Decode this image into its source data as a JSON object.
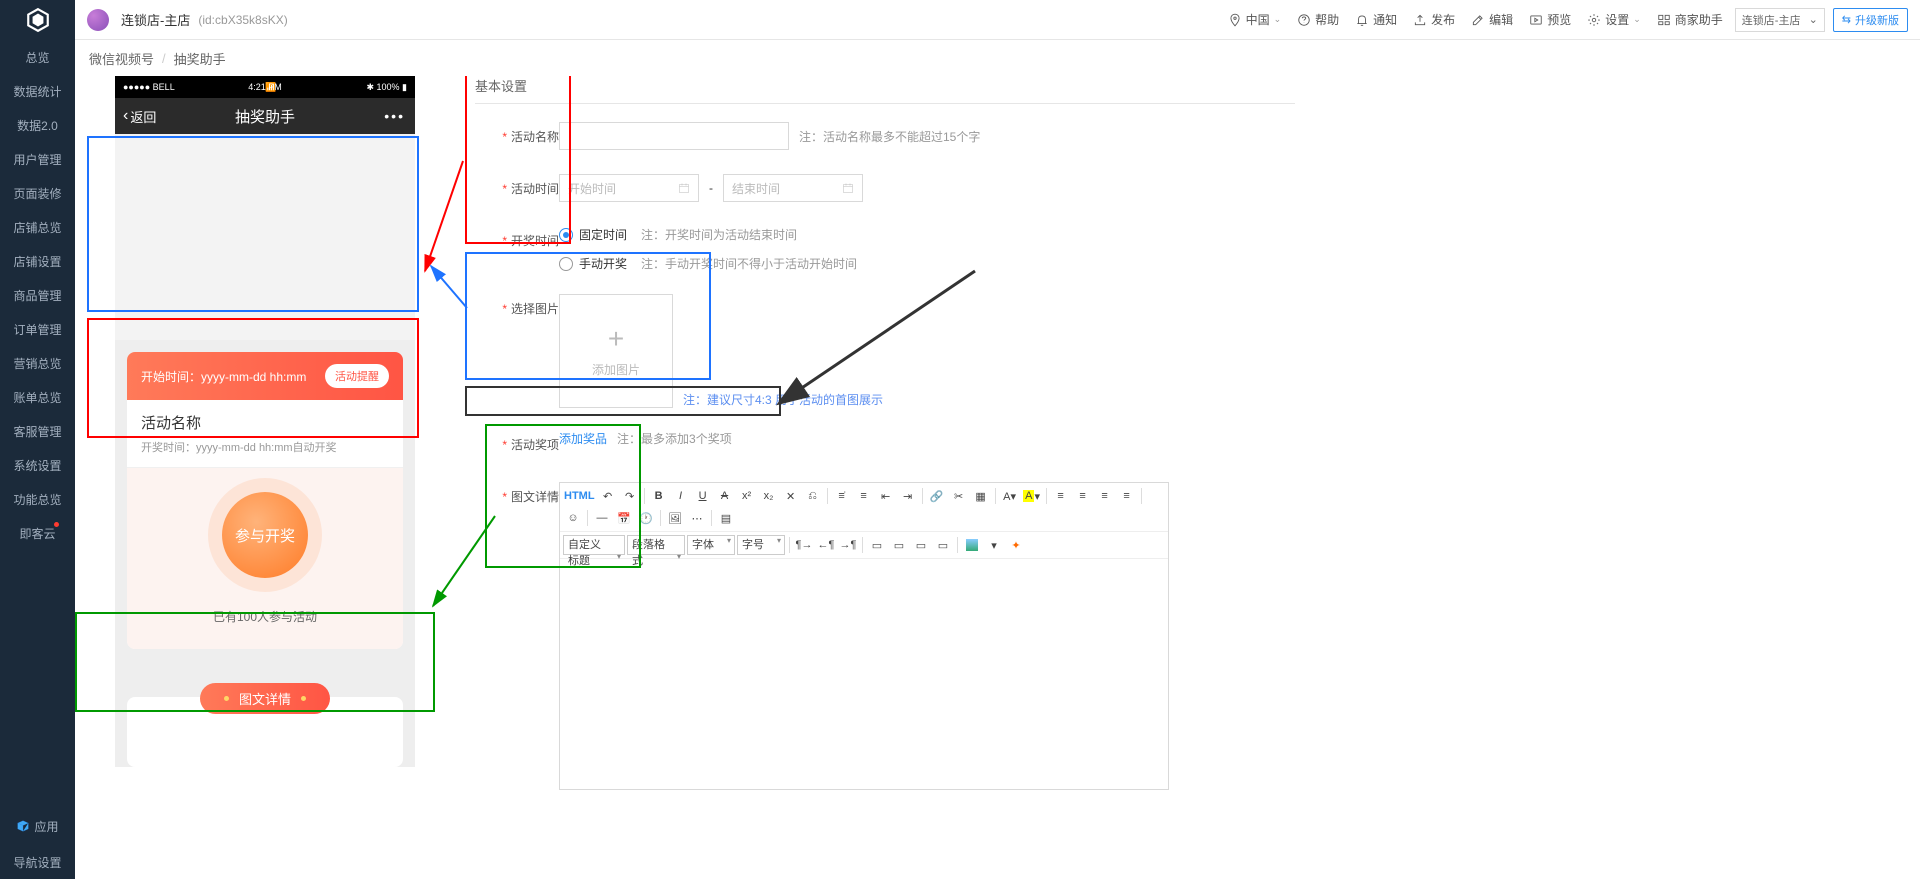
{
  "sidebar": {
    "items": [
      "总览",
      "数据统计",
      "数据2.0",
      "用户管理",
      "页面装修",
      "店铺总览",
      "店铺设置",
      "商品管理",
      "订单管理",
      "营销总览",
      "账单总览",
      "客服管理",
      "系统设置",
      "功能总览",
      "即客云"
    ],
    "app": "应用",
    "nav_settings": "导航设置"
  },
  "header": {
    "shop_name": "连锁店-主店",
    "shop_id": "(id:cbX35k8sKX)",
    "region": "中国",
    "help": "帮助",
    "notify": "通知",
    "publish": "发布",
    "edit": "编辑",
    "preview": "预览",
    "settings": "设置",
    "assistant": "商家助手",
    "shop_select": "连锁店-主店",
    "upgrade": "升级新版"
  },
  "breadcrumb": {
    "a": "微信视频号",
    "b": "抽奖助手"
  },
  "phone": {
    "carrier": "●●●●● BELL",
    "time": "4:21 PM",
    "battery": "100%",
    "back": "返回",
    "title": "抽奖助手",
    "start_label": "开始时间：",
    "start_val": "yyyy-mm-dd hh:mm",
    "remind": "活动提醒",
    "act_name": "活动名称",
    "open_label": "开奖时间：yyyy-mm-dd hh:mm自动开奖",
    "join": "参与开奖",
    "count": "已有100人参与活动",
    "detail": "图文详情"
  },
  "form": {
    "section": "基本设置",
    "name_lbl": "活动名称",
    "name_note": "注：活动名称最多不能超过15个字",
    "time_lbl": "活动时间",
    "start_ph": "开始时间",
    "end_ph": "结束时间",
    "open_lbl": "开奖时间",
    "open_fixed": "固定时间",
    "open_fixed_note": "注：开奖时间为活动结束时间",
    "open_manual": "手动开奖",
    "open_manual_note": "注：手动开奖时间不得小于活动开始时间",
    "img_lbl": "选择图片",
    "upload": "添加图片",
    "img_note": "注：建议尺寸4:3 用于活动的首图展示",
    "prize_lbl": "活动奖项",
    "add_prize": "添加奖品",
    "prize_note": "注：最多添加3个奖项",
    "detail_lbl": "图文详情",
    "toolbar": {
      "html": "HTML",
      "css": "自定义标题",
      "para": "段落格式",
      "font": "字体",
      "size": "字号"
    }
  }
}
